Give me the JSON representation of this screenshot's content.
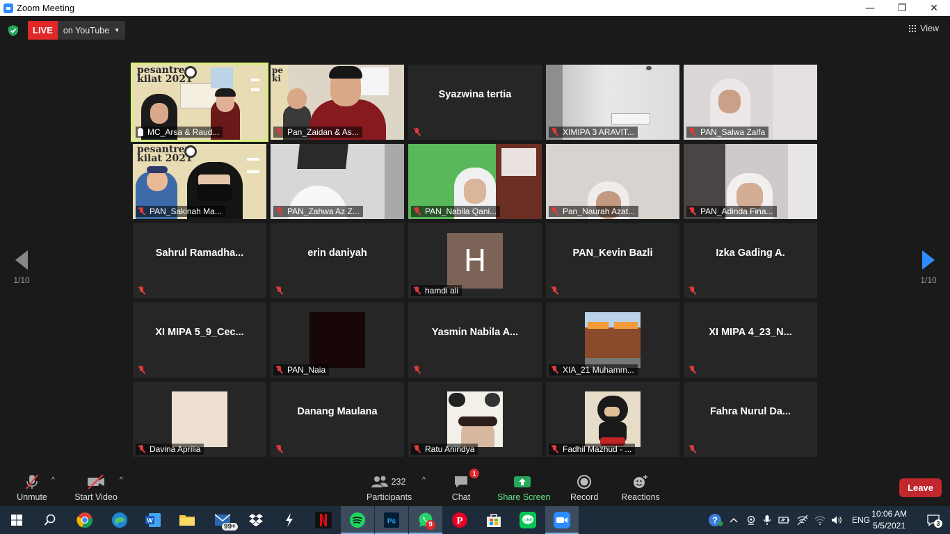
{
  "window": {
    "title": "Zoom Meeting",
    "min": "—",
    "max": "❐",
    "close": "✕"
  },
  "top": {
    "live": "LIVE",
    "destination": "on YouTube",
    "view": "View"
  },
  "pager": {
    "left": "1/10",
    "right": "1/10"
  },
  "tiles": [
    {
      "name": "MC_Arsa & Raud...",
      "muted": false,
      "kind": "video",
      "scene": "pesantren1",
      "active": true
    },
    {
      "name": "Pan_Zaidan & As...",
      "muted": true,
      "kind": "video",
      "scene": "boys"
    },
    {
      "name": "Syazwina tertia",
      "muted": true,
      "kind": "name"
    },
    {
      "name": "XIMIPA 3 ARAVIT...",
      "muted": true,
      "kind": "video",
      "scene": "room"
    },
    {
      "name": "PAN_Salwa Zalfa",
      "muted": true,
      "kind": "video",
      "scene": "girl1"
    },
    {
      "name": "PAN_Sakinah Ma...",
      "muted": true,
      "kind": "video",
      "scene": "pesantren2"
    },
    {
      "name": "PAN_Zahwa Az Z...",
      "muted": true,
      "kind": "video",
      "scene": "ceiling"
    },
    {
      "name": "PAN_Nabila Qani...",
      "muted": true,
      "kind": "video",
      "scene": "green"
    },
    {
      "name": "Pan_Naurah Azat...",
      "muted": true,
      "kind": "video",
      "scene": "girl2"
    },
    {
      "name": "PAN_Adinda Fina...",
      "muted": true,
      "kind": "video",
      "scene": "girl3"
    },
    {
      "name": "Sahrul  Ramadha...",
      "muted": true,
      "kind": "name"
    },
    {
      "name": "erin daniyah",
      "muted": true,
      "kind": "name"
    },
    {
      "name": "hamdi ali",
      "muted": true,
      "kind": "avatar",
      "avatar": "H",
      "avatar_style": "avatar-h"
    },
    {
      "name": "PAN_Kevin Bazli",
      "muted": true,
      "kind": "name"
    },
    {
      "name": "Izka Gading A.",
      "muted": true,
      "kind": "name"
    },
    {
      "name": "XI MIPA 5_9_Cec...",
      "muted": true,
      "kind": "name"
    },
    {
      "name": "PAN_Naia",
      "muted": true,
      "kind": "avatar",
      "avatar": "",
      "avatar_style": "avatar-dark"
    },
    {
      "name": "Yasmin Nabila A...",
      "muted": true,
      "kind": "name"
    },
    {
      "name": "XIA_21 Muhamm...",
      "muted": true,
      "kind": "avatar",
      "avatar": "",
      "avatar_style": "avatar-pic",
      "pic": "hooters"
    },
    {
      "name": "XI MIPA 4_23_N...",
      "muted": true,
      "kind": "name"
    },
    {
      "name": "Davina Aprilia",
      "muted": true,
      "kind": "avatar",
      "avatar": "",
      "avatar_style": "avatar-cream"
    },
    {
      "name": "Danang Maulana",
      "muted": true,
      "kind": "name"
    },
    {
      "name": "Ratu Anindya",
      "muted": true,
      "kind": "avatar",
      "avatar": "",
      "avatar_style": "avatar-pic",
      "pic": "panda"
    },
    {
      "name": "Fadhil Mazhud - ...",
      "muted": true,
      "kind": "avatar",
      "avatar": "",
      "avatar_style": "avatar-pic",
      "pic": "shadow"
    },
    {
      "name": "Fahra Nurul Da...",
      "muted": true,
      "kind": "name"
    }
  ],
  "toolbar": {
    "unmute": "Unmute",
    "start_video": "Start Video",
    "participants": "Participants",
    "participants_count": "232",
    "chat": "Chat",
    "chat_badge": "1",
    "share": "Share Screen",
    "record": "Record",
    "reactions": "Reactions",
    "leave": "Leave"
  },
  "taskbar": {
    "mail_badge": "99+",
    "whatsapp_badge": "9",
    "lang": "ENG",
    "time": "10:06 AM",
    "date": "5/5/2021",
    "notif": "3"
  },
  "colors": {
    "accent": "#2d8cff",
    "live": "#e02828",
    "leave": "#c1272d",
    "share": "#5ee28a",
    "active_outline": "#d6f07c"
  }
}
